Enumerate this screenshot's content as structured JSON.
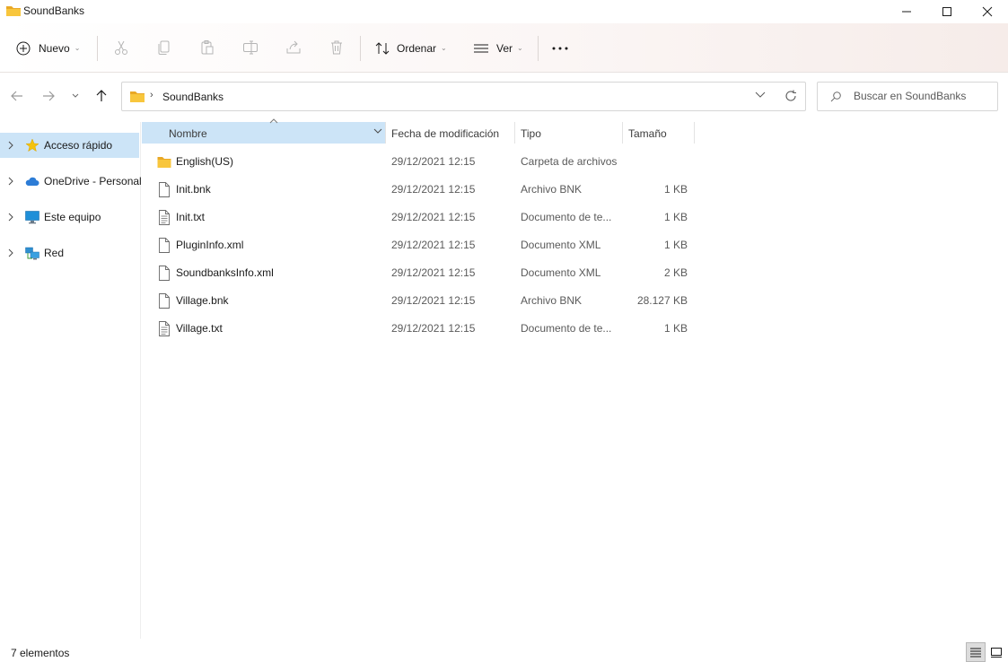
{
  "window": {
    "title": "SoundBanks",
    "controls": [
      "minimize",
      "maximize",
      "close"
    ]
  },
  "toolbar": {
    "new_label": "Nuevo",
    "sort_label": "Ordenar",
    "view_label": "Ver",
    "actions": [
      "cut-icon",
      "copy-icon",
      "paste-icon",
      "rename-icon",
      "share-icon",
      "delete-icon"
    ],
    "more_label": "···"
  },
  "address": {
    "crumb": "SoundBanks",
    "search_placeholder": "Buscar en SoundBanks"
  },
  "sidebar": {
    "items": [
      {
        "label": "Acceso rápido",
        "icon": "star-icon",
        "selected": true
      },
      {
        "label": "OneDrive - Personal",
        "icon": "cloud-icon",
        "selected": false
      },
      {
        "label": "Este equipo",
        "icon": "monitor-icon",
        "selected": false
      },
      {
        "label": "Red",
        "icon": "network-icon",
        "selected": false
      }
    ]
  },
  "columns": {
    "name": "Nombre",
    "date": "Fecha de modificación",
    "type": "Tipo",
    "size": "Tamaño"
  },
  "files": [
    {
      "name": "English(US)",
      "date": "29/12/2021 12:15",
      "type": "Carpeta de archivos",
      "size": "",
      "icon": "folder-icon"
    },
    {
      "name": "Init.bnk",
      "date": "29/12/2021 12:15",
      "type": "Archivo BNK",
      "size": "1 KB",
      "icon": "file-icon"
    },
    {
      "name": "Init.txt",
      "date": "29/12/2021 12:15",
      "type": "Documento de te...",
      "size": "1 KB",
      "icon": "text-file-icon"
    },
    {
      "name": "PluginInfo.xml",
      "date": "29/12/2021 12:15",
      "type": "Documento XML",
      "size": "1 KB",
      "icon": "file-icon"
    },
    {
      "name": "SoundbanksInfo.xml",
      "date": "29/12/2021 12:15",
      "type": "Documento XML",
      "size": "2 KB",
      "icon": "file-icon"
    },
    {
      "name": "Village.bnk",
      "date": "29/12/2021 12:15",
      "type": "Archivo BNK",
      "size": "28.127 KB",
      "icon": "file-icon"
    },
    {
      "name": "Village.txt",
      "date": "29/12/2021 12:15",
      "type": "Documento de te...",
      "size": "1 KB",
      "icon": "text-file-icon"
    }
  ],
  "status": {
    "count": "7 elementos"
  },
  "colors": {
    "accent_selection": "#cce4f7",
    "folder": "#f8c63d",
    "star": "#f4c20d",
    "onedrive": "#2c7cd6"
  }
}
